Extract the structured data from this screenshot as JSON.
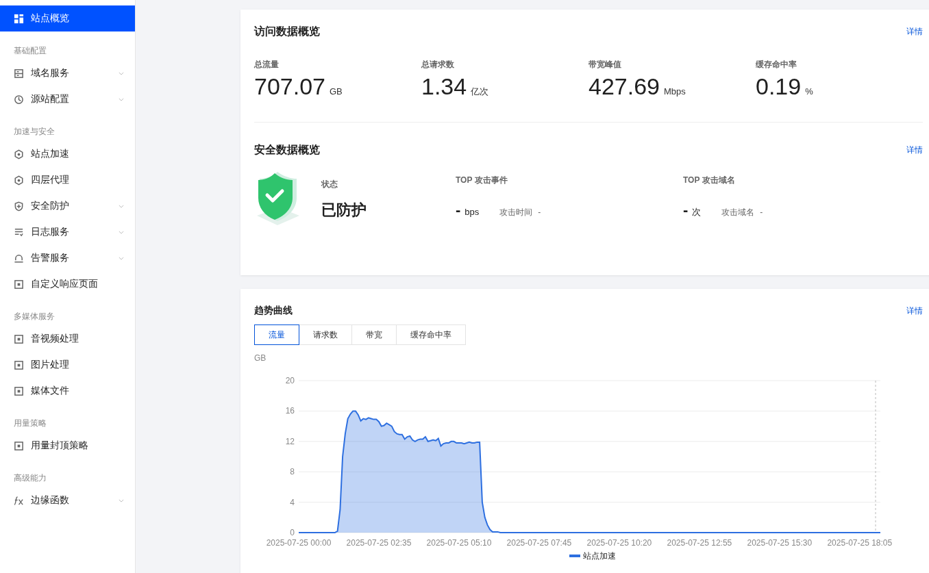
{
  "sidebar": {
    "items": [
      {
        "kind": "item",
        "label": "站点概览",
        "selected": true,
        "expandable": false
      },
      {
        "kind": "heading",
        "label": "基础配置"
      },
      {
        "kind": "item",
        "label": "域名服务",
        "selected": false,
        "expandable": true
      },
      {
        "kind": "item",
        "label": "源站配置",
        "selected": false,
        "expandable": true
      },
      {
        "kind": "heading",
        "label": "加速与安全"
      },
      {
        "kind": "item",
        "label": "站点加速",
        "selected": false,
        "expandable": false
      },
      {
        "kind": "item",
        "label": "四层代理",
        "selected": false,
        "expandable": false
      },
      {
        "kind": "item",
        "label": "安全防护",
        "selected": false,
        "expandable": true
      },
      {
        "kind": "item",
        "label": "日志服务",
        "selected": false,
        "expandable": true
      },
      {
        "kind": "item",
        "label": "告警服务",
        "selected": false,
        "expandable": true
      },
      {
        "kind": "item",
        "label": "自定义响应页面",
        "selected": false,
        "expandable": false
      },
      {
        "kind": "heading",
        "label": "多媒体服务"
      },
      {
        "kind": "item",
        "label": "音视频处理",
        "selected": false,
        "expandable": false
      },
      {
        "kind": "item",
        "label": "图片处理",
        "selected": false,
        "expandable": false
      },
      {
        "kind": "item",
        "label": "媒体文件",
        "selected": false,
        "expandable": false
      },
      {
        "kind": "heading",
        "label": "用量策略"
      },
      {
        "kind": "item",
        "label": "用量封顶策略",
        "selected": false,
        "expandable": false
      },
      {
        "kind": "heading",
        "label": "高级能力"
      },
      {
        "kind": "item",
        "label": "边缘函数",
        "selected": false,
        "expandable": true
      }
    ]
  },
  "access_overview": {
    "title": "访问数据概览",
    "link": "详情",
    "stats": [
      {
        "label": "总流量",
        "value": "707.07",
        "unit": "GB"
      },
      {
        "label": "总请求数",
        "value": "1.34",
        "unit": "亿次"
      },
      {
        "label": "带宽峰值",
        "value": "427.69",
        "unit": "Mbps"
      },
      {
        "label": "缓存命中率",
        "value": "0.19",
        "unit": "%"
      }
    ]
  },
  "security_overview": {
    "title": "安全数据概览",
    "link": "详情",
    "status_label": "状态",
    "status_value": "已防护",
    "top": [
      {
        "label": "TOP 攻击事件",
        "value": "-",
        "unit": "bps",
        "sub_label": "攻击时间",
        "sub_value": "-"
      },
      {
        "label": "TOP 攻击域名",
        "value": "-",
        "unit": "次",
        "sub_label": "攻击域名",
        "sub_value": "-"
      }
    ]
  },
  "trend": {
    "title": "趋势曲线",
    "link": "详情",
    "tabs": [
      {
        "label": "流量",
        "selected": true
      },
      {
        "label": "请求数",
        "selected": false
      },
      {
        "label": "带宽",
        "selected": false
      },
      {
        "label": "缓存命中率",
        "selected": false
      }
    ],
    "unit": "GB",
    "chart_data": {
      "type": "area",
      "grid": true,
      "ylim": [
        0,
        20
      ],
      "yticks": [
        0,
        4,
        8,
        12,
        16,
        20
      ],
      "categories": [
        "2025-07-25 00:00",
        null,
        null,
        null,
        null,
        null,
        null,
        null,
        null,
        null,
        null,
        null,
        null,
        null,
        null,
        null,
        null,
        null,
        null,
        null,
        null,
        null,
        null,
        null,
        null,
        null,
        null,
        null,
        null,
        null,
        null,
        "2025-07-25 02:35",
        null,
        null,
        null,
        null,
        null,
        null,
        null,
        null,
        null,
        null,
        null,
        null,
        null,
        null,
        null,
        null,
        null,
        null,
        null,
        null,
        null,
        null,
        null,
        null,
        null,
        null,
        null,
        null,
        null,
        null,
        "2025-07-25 05:10",
        null,
        null,
        null,
        null,
        null,
        null,
        null,
        null,
        null,
        null,
        null,
        null,
        null,
        null,
        null,
        null,
        null,
        null,
        null,
        null,
        null,
        null,
        null,
        null,
        null,
        null,
        null,
        null,
        null,
        null,
        "2025-07-25 07:45",
        null,
        null,
        null,
        null,
        null,
        null,
        null,
        null,
        null,
        null,
        null,
        null,
        null,
        null,
        null,
        null,
        null,
        null,
        null,
        null,
        null,
        null,
        null,
        null,
        null,
        null,
        null,
        null,
        null,
        null,
        "2025-07-25 10:20",
        null,
        null,
        null,
        null,
        null,
        null,
        null,
        null,
        null,
        null,
        null,
        null,
        null,
        null,
        null,
        null,
        null,
        null,
        null,
        null,
        null,
        null,
        null,
        null,
        null,
        null,
        null,
        null,
        null,
        null,
        "2025-07-25 12:55",
        null,
        null,
        null,
        null,
        null,
        null,
        null,
        null,
        null,
        null,
        null,
        null,
        null,
        null,
        null,
        null,
        null,
        null,
        null,
        null,
        null,
        null,
        null,
        null,
        null,
        null,
        null,
        null,
        null,
        null,
        "2025-07-25 15:30",
        null,
        null,
        null,
        null,
        null,
        null,
        null,
        null,
        null,
        null,
        null,
        null,
        null,
        null,
        null,
        null,
        null,
        null,
        null,
        null,
        null,
        null,
        null,
        null,
        null,
        null,
        null,
        null,
        null,
        null,
        "2025-07-25 18:05",
        null,
        null,
        null,
        null,
        null,
        null,
        null,
        null
      ],
      "series": [
        {
          "name": "站点加速",
          "color": "#2d6fe0",
          "values": [
            0,
            0,
            0,
            0,
            0,
            0,
            0,
            0,
            0,
            0,
            0,
            0,
            0,
            0,
            0,
            0.2,
            3,
            10,
            13,
            15,
            15.6,
            16,
            16,
            15.5,
            14.7,
            15,
            14.9,
            15.1,
            15,
            14.9,
            14.9,
            14.6,
            14,
            14.1,
            14.4,
            14.2,
            14,
            13.3,
            13,
            12.9,
            12.9,
            12.3,
            12.6,
            12.7,
            12.2,
            12,
            12.2,
            12.3,
            12.3,
            12.6,
            12,
            12.1,
            12.2,
            12.1,
            12.4,
            11.4,
            11.7,
            11.8,
            11.8,
            12,
            12,
            11.8,
            11.8,
            11.8,
            11.7,
            11.8,
            11.9,
            11.8,
            11.8,
            11.9,
            11.9,
            4,
            2,
            1,
            0.4,
            0.1,
            0.1,
            0.1,
            0,
            0,
            0,
            0,
            0,
            0,
            0,
            0,
            0,
            0,
            0,
            0,
            0,
            0,
            0,
            0,
            0,
            0,
            0,
            0,
            0,
            0,
            0,
            0,
            0,
            0,
            0,
            0,
            0,
            0,
            0,
            0,
            0,
            0,
            0,
            0,
            0,
            0,
            0,
            0,
            0,
            0,
            0,
            0,
            0,
            0,
            0,
            0,
            0,
            0,
            0,
            0,
            0,
            0,
            0,
            0,
            0,
            0,
            0,
            0,
            0,
            0,
            0,
            0,
            0,
            0,
            0,
            0,
            0,
            0,
            0,
            0,
            0,
            0,
            0,
            0,
            0,
            0,
            0,
            0,
            0,
            0,
            0,
            0,
            0,
            0,
            0,
            0,
            0,
            0,
            0,
            0,
            0,
            0,
            0,
            0,
            0,
            0,
            0,
            0,
            0,
            0,
            0,
            0,
            0,
            0,
            0,
            0,
            0,
            0,
            0,
            0,
            0,
            0,
            0,
            0,
            0,
            0,
            0,
            0,
            0,
            0,
            0,
            0,
            0,
            0,
            0,
            0,
            0,
            0,
            0,
            0,
            0,
            0,
            0,
            0,
            0,
            0,
            0,
            0,
            0,
            0,
            0,
            0,
            0,
            0,
            0,
            0
          ]
        }
      ]
    }
  }
}
